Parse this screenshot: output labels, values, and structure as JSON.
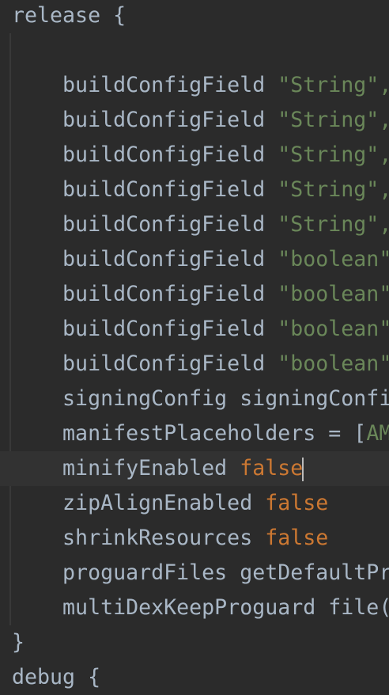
{
  "colors": {
    "background": "#2b2b2b",
    "text": "#a9b7c6",
    "string": "#6a8759",
    "keyword": "#cc7832",
    "current_line": "#323232"
  },
  "lines": [
    {
      "indent": "",
      "code": "release {",
      "lit": ""
    },
    {
      "indent": "",
      "code": "",
      "lit": ""
    },
    {
      "indent": "    ",
      "code": "buildConfigField ",
      "lit": "\"String\",",
      "type": "str"
    },
    {
      "indent": "    ",
      "code": "buildConfigField ",
      "lit": "\"String\",",
      "type": "str"
    },
    {
      "indent": "    ",
      "code": "buildConfigField ",
      "lit": "\"String\",",
      "type": "str"
    },
    {
      "indent": "    ",
      "code": "buildConfigField ",
      "lit": "\"String\",",
      "type": "str"
    },
    {
      "indent": "    ",
      "code": "buildConfigField ",
      "lit": "\"String\",",
      "type": "str"
    },
    {
      "indent": "    ",
      "code": "buildConfigField ",
      "lit": "\"boolean\"",
      "type": "str"
    },
    {
      "indent": "    ",
      "code": "buildConfigField ",
      "lit": "\"boolean\"",
      "type": "str"
    },
    {
      "indent": "    ",
      "code": "buildConfigField ",
      "lit": "\"boolean\"",
      "type": "str"
    },
    {
      "indent": "    ",
      "code": "buildConfigField ",
      "lit": "\"boolean\"",
      "type": "str"
    },
    {
      "indent": "    ",
      "code": "signingConfig signingConfi",
      "lit": ""
    },
    {
      "indent": "    ",
      "code": "manifestPlaceholders = [",
      "lit": "AM",
      "type": "str"
    },
    {
      "indent": "    ",
      "code": "minifyEnabled ",
      "lit": "false",
      "type": "kw",
      "current": true
    },
    {
      "indent": "    ",
      "code": "zipAlignEnabled ",
      "lit": "false",
      "type": "kw"
    },
    {
      "indent": "    ",
      "code": "shrinkResources ",
      "lit": "false",
      "type": "kw"
    },
    {
      "indent": "    ",
      "code": "proguardFiles getDefaultPr",
      "lit": ""
    },
    {
      "indent": "    ",
      "code": "multiDexKeepProguard file(",
      "lit": ""
    },
    {
      "indent": "",
      "code": "}",
      "lit": ""
    },
    {
      "indent": "",
      "code": "debug {",
      "lit": ""
    }
  ]
}
